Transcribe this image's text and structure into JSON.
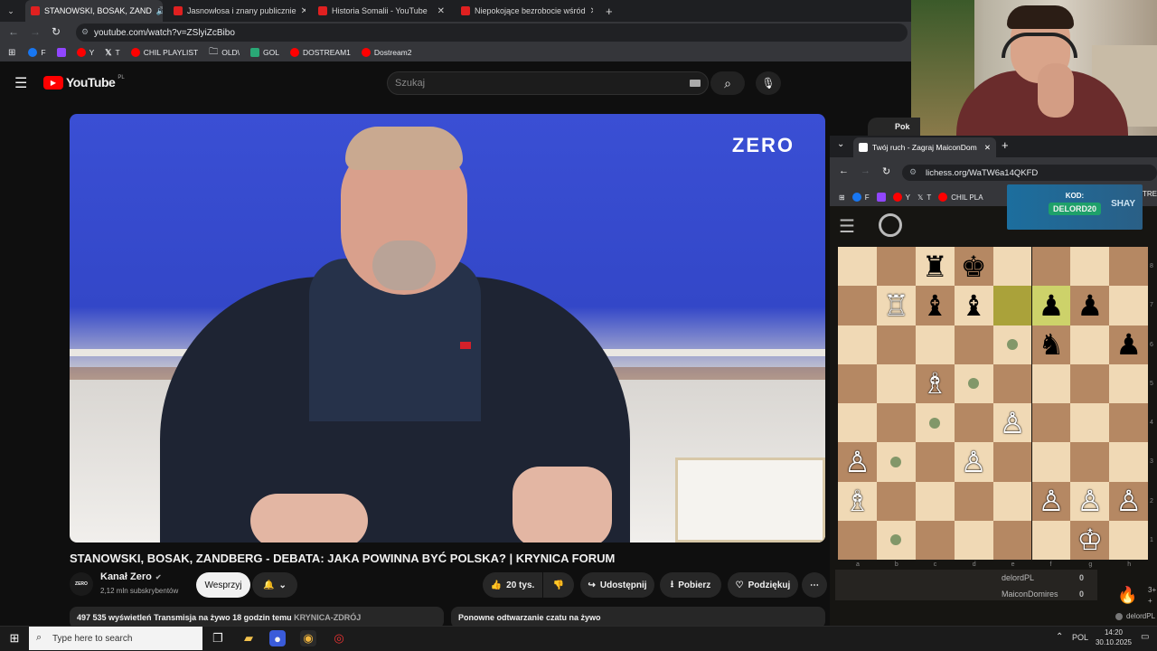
{
  "browser": {
    "tabs": [
      {
        "label": "STANOWSKI, BOSAK, ZAND",
        "active": true
      },
      {
        "label": "Jasnowłosa i znany publicznie",
        "active": false
      },
      {
        "label": "Historia Somalii - YouTube",
        "active": false
      },
      {
        "label": "Niepokojące bezrobocie wśród",
        "active": false
      }
    ],
    "new_tab_symbol": "+",
    "url": "youtube.com/watch?v=ZSlyiZcBibo",
    "bookmarks": [
      {
        "label": "F",
        "color": "#1877f2"
      },
      {
        "label": "",
        "color": "#9146ff"
      },
      {
        "label": "Y",
        "color": "#ff0000"
      },
      {
        "label": "T",
        "color": "#000000"
      },
      {
        "label": "CHIL PLAYLIST",
        "color": "#ff0000"
      },
      {
        "label": "OLD\\",
        "color": "folder"
      },
      {
        "label": "GOL",
        "color": "#2aa876"
      },
      {
        "label": "DOSTREAM1",
        "color": "#ff0000"
      },
      {
        "label": "Dostream2",
        "color": "#ff0000"
      }
    ]
  },
  "youtube": {
    "logo_text": "YouTube",
    "logo_region": "PL",
    "search_placeholder": "Szukaj",
    "video_overlay_brand": "ZERO",
    "title": "STANOWSKI, BOSAK, ZANDBERG - DEBATA: JAKA POWINNA BYĆ POLSKA? | KRYNICA FORUM",
    "channel": {
      "name": "Kanał Zero",
      "subscribers": "2,12 mln subskrybentów",
      "avatar_text": "ZERO",
      "support_label": "Wesprzyj"
    },
    "actions": {
      "likes": "20 tys.",
      "share": "Udostępnij",
      "download": "Pobierz",
      "thanks": "Podziękuj"
    },
    "description": {
      "views": "497 535 wyświetleń",
      "streamed": "Transmisja na żywo 18 godzin temu",
      "location": "KRYNICA-ZDRÓJ"
    },
    "chat_replay": "Ponowne odtwarzanie czatu na żywo",
    "partial_button": "Pok"
  },
  "lichess": {
    "tab_title": "Twój ruch - Zagraj MaiconDom",
    "url": "lichess.org/WaTW6a14QKFD",
    "bookmarks": [
      "F",
      "",
      "Y",
      "T",
      "CHIL PLA"
    ],
    "overlay": {
      "label": "KOD:",
      "code": "DELORD20",
      "brand": "SHAY",
      "partial": "TREA"
    },
    "board_rows": [
      [
        "",
        "",
        "♜",
        "♚",
        "",
        "",
        "",
        ""
      ],
      [
        "",
        "♖",
        "♝",
        "♝",
        "",
        "♟",
        "♟",
        ""
      ],
      [
        "",
        "",
        "",
        "",
        "",
        "♞",
        "",
        "♟"
      ],
      [
        "",
        "",
        "♗",
        "",
        "",
        "",
        "",
        ""
      ],
      [
        "",
        "",
        "",
        "",
        "♙",
        "",
        "",
        ""
      ],
      [
        "♙",
        "",
        "",
        "♙",
        "",
        "",
        "",
        ""
      ],
      [
        "♗",
        "",
        "",
        "",
        "",
        "♙",
        "♙",
        "♙"
      ],
      [
        "",
        "",
        "",
        "",
        "",
        "",
        "♔",
        ""
      ]
    ],
    "files": [
      "a",
      "b",
      "c",
      "d",
      "e",
      "f",
      "g",
      "h"
    ],
    "ranks": [
      "8",
      "7",
      "6",
      "5",
      "4",
      "3",
      "2",
      "1"
    ],
    "players": [
      {
        "name": "delordPL",
        "score": "0"
      },
      {
        "name": "MaiconDomires",
        "score": "0"
      }
    ],
    "side_numbers": [
      "3+",
      "+"
    ],
    "side_user": "delordPL"
  },
  "taskbar": {
    "search_placeholder": "Type here to search",
    "language": "POL",
    "time": "14:20",
    "date": "30.10.2025"
  }
}
